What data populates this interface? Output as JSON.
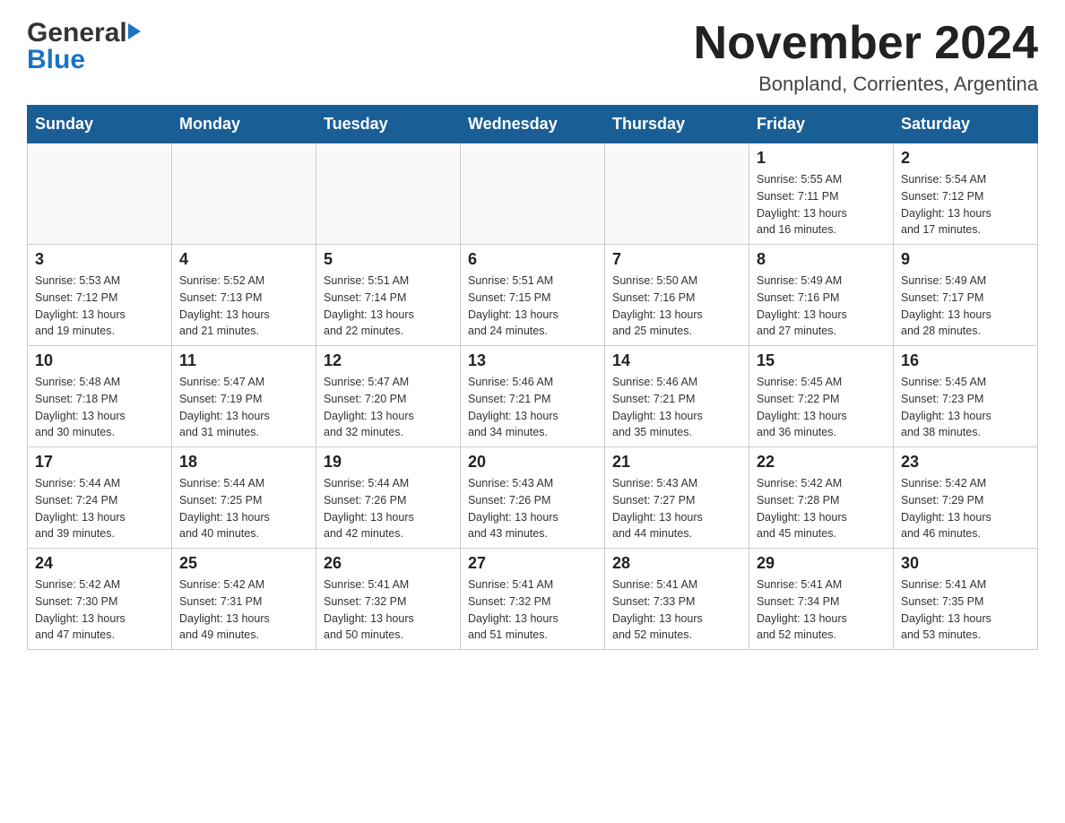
{
  "header": {
    "logo_general": "General",
    "logo_blue": "Blue",
    "month_title": "November 2024",
    "location": "Bonpland, Corrientes, Argentina"
  },
  "weekdays": [
    "Sunday",
    "Monday",
    "Tuesday",
    "Wednesday",
    "Thursday",
    "Friday",
    "Saturday"
  ],
  "weeks": [
    {
      "days": [
        {
          "num": "",
          "info": ""
        },
        {
          "num": "",
          "info": ""
        },
        {
          "num": "",
          "info": ""
        },
        {
          "num": "",
          "info": ""
        },
        {
          "num": "",
          "info": ""
        },
        {
          "num": "1",
          "info": "Sunrise: 5:55 AM\nSunset: 7:11 PM\nDaylight: 13 hours\nand 16 minutes."
        },
        {
          "num": "2",
          "info": "Sunrise: 5:54 AM\nSunset: 7:12 PM\nDaylight: 13 hours\nand 17 minutes."
        }
      ]
    },
    {
      "days": [
        {
          "num": "3",
          "info": "Sunrise: 5:53 AM\nSunset: 7:12 PM\nDaylight: 13 hours\nand 19 minutes."
        },
        {
          "num": "4",
          "info": "Sunrise: 5:52 AM\nSunset: 7:13 PM\nDaylight: 13 hours\nand 21 minutes."
        },
        {
          "num": "5",
          "info": "Sunrise: 5:51 AM\nSunset: 7:14 PM\nDaylight: 13 hours\nand 22 minutes."
        },
        {
          "num": "6",
          "info": "Sunrise: 5:51 AM\nSunset: 7:15 PM\nDaylight: 13 hours\nand 24 minutes."
        },
        {
          "num": "7",
          "info": "Sunrise: 5:50 AM\nSunset: 7:16 PM\nDaylight: 13 hours\nand 25 minutes."
        },
        {
          "num": "8",
          "info": "Sunrise: 5:49 AM\nSunset: 7:16 PM\nDaylight: 13 hours\nand 27 minutes."
        },
        {
          "num": "9",
          "info": "Sunrise: 5:49 AM\nSunset: 7:17 PM\nDaylight: 13 hours\nand 28 minutes."
        }
      ]
    },
    {
      "days": [
        {
          "num": "10",
          "info": "Sunrise: 5:48 AM\nSunset: 7:18 PM\nDaylight: 13 hours\nand 30 minutes."
        },
        {
          "num": "11",
          "info": "Sunrise: 5:47 AM\nSunset: 7:19 PM\nDaylight: 13 hours\nand 31 minutes."
        },
        {
          "num": "12",
          "info": "Sunrise: 5:47 AM\nSunset: 7:20 PM\nDaylight: 13 hours\nand 32 minutes."
        },
        {
          "num": "13",
          "info": "Sunrise: 5:46 AM\nSunset: 7:21 PM\nDaylight: 13 hours\nand 34 minutes."
        },
        {
          "num": "14",
          "info": "Sunrise: 5:46 AM\nSunset: 7:21 PM\nDaylight: 13 hours\nand 35 minutes."
        },
        {
          "num": "15",
          "info": "Sunrise: 5:45 AM\nSunset: 7:22 PM\nDaylight: 13 hours\nand 36 minutes."
        },
        {
          "num": "16",
          "info": "Sunrise: 5:45 AM\nSunset: 7:23 PM\nDaylight: 13 hours\nand 38 minutes."
        }
      ]
    },
    {
      "days": [
        {
          "num": "17",
          "info": "Sunrise: 5:44 AM\nSunset: 7:24 PM\nDaylight: 13 hours\nand 39 minutes."
        },
        {
          "num": "18",
          "info": "Sunrise: 5:44 AM\nSunset: 7:25 PM\nDaylight: 13 hours\nand 40 minutes."
        },
        {
          "num": "19",
          "info": "Sunrise: 5:44 AM\nSunset: 7:26 PM\nDaylight: 13 hours\nand 42 minutes."
        },
        {
          "num": "20",
          "info": "Sunrise: 5:43 AM\nSunset: 7:26 PM\nDaylight: 13 hours\nand 43 minutes."
        },
        {
          "num": "21",
          "info": "Sunrise: 5:43 AM\nSunset: 7:27 PM\nDaylight: 13 hours\nand 44 minutes."
        },
        {
          "num": "22",
          "info": "Sunrise: 5:42 AM\nSunset: 7:28 PM\nDaylight: 13 hours\nand 45 minutes."
        },
        {
          "num": "23",
          "info": "Sunrise: 5:42 AM\nSunset: 7:29 PM\nDaylight: 13 hours\nand 46 minutes."
        }
      ]
    },
    {
      "days": [
        {
          "num": "24",
          "info": "Sunrise: 5:42 AM\nSunset: 7:30 PM\nDaylight: 13 hours\nand 47 minutes."
        },
        {
          "num": "25",
          "info": "Sunrise: 5:42 AM\nSunset: 7:31 PM\nDaylight: 13 hours\nand 49 minutes."
        },
        {
          "num": "26",
          "info": "Sunrise: 5:41 AM\nSunset: 7:32 PM\nDaylight: 13 hours\nand 50 minutes."
        },
        {
          "num": "27",
          "info": "Sunrise: 5:41 AM\nSunset: 7:32 PM\nDaylight: 13 hours\nand 51 minutes."
        },
        {
          "num": "28",
          "info": "Sunrise: 5:41 AM\nSunset: 7:33 PM\nDaylight: 13 hours\nand 52 minutes."
        },
        {
          "num": "29",
          "info": "Sunrise: 5:41 AM\nSunset: 7:34 PM\nDaylight: 13 hours\nand 52 minutes."
        },
        {
          "num": "30",
          "info": "Sunrise: 5:41 AM\nSunset: 7:35 PM\nDaylight: 13 hours\nand 53 minutes."
        }
      ]
    }
  ]
}
